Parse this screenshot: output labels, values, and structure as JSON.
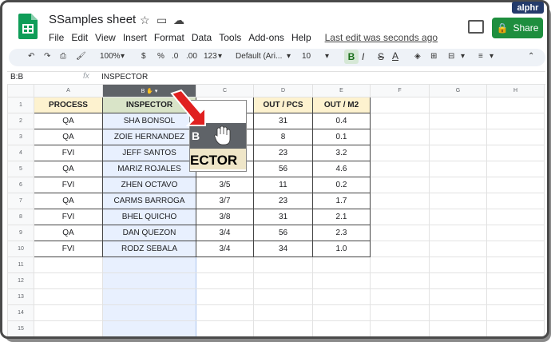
{
  "watermark": "alphr",
  "app": {
    "title": "SSamples sheet",
    "menu": [
      "File",
      "Edit",
      "View",
      "Insert",
      "Format",
      "Data",
      "Tools",
      "Add-ons",
      "Help"
    ],
    "last_edit": "Last edit was seconds ago",
    "share_label": "Share",
    "logo_color": "#0f9d58",
    "share_color": "#1e8e3e"
  },
  "toolbar": {
    "zoom": "100%",
    "currency": "$",
    "percent": "%",
    "dec_less": ".0",
    "dec_more": ".00",
    "number_format": "123",
    "font": "Default (Ari...",
    "font_size": "10",
    "bold": "B",
    "italic": "I",
    "strike": "S",
    "text_color": "A"
  },
  "formula_bar": {
    "name_box": "B:B",
    "fx": "fx",
    "value": "INSPECTOR"
  },
  "columns": [
    "A",
    "B",
    "C",
    "D",
    "E",
    "F",
    "G",
    "H"
  ],
  "table": {
    "headers": [
      "PROCESS",
      "INSPECTOR",
      "",
      "OUT / PCS",
      "OUT / M2"
    ],
    "rows": [
      [
        "QA",
        "SHA BONSOL",
        "",
        "31",
        "0.4"
      ],
      [
        "QA",
        "ZOIE HERNANDEZ",
        "",
        "8",
        "0.1"
      ],
      [
        "FVI",
        "JEFF SANTOS",
        "",
        "23",
        "3.2"
      ],
      [
        "QA",
        "MARIZ ROJALES",
        "",
        "56",
        "4.6"
      ],
      [
        "FVI",
        "ZHEN OCTAVO",
        "3/5",
        "11",
        "0.2"
      ],
      [
        "QA",
        "CARMS BARROGA",
        "3/7",
        "23",
        "1.7"
      ],
      [
        "FVI",
        "BHEL QUICHO",
        "3/8",
        "31",
        "2.1"
      ],
      [
        "QA",
        "DAN QUEZON",
        "3/4",
        "56",
        "2.3"
      ],
      [
        "FVI",
        "RODZ SEBALA",
        "3/4",
        "34",
        "1.0"
      ]
    ],
    "row_numbers": [
      "1",
      "2",
      "3",
      "4",
      "5",
      "6",
      "7",
      "8",
      "9",
      "10",
      "11",
      "12",
      "13",
      "14",
      "15"
    ]
  },
  "drag_preview": {
    "col_letter": "B",
    "fragment": "ECTOR"
  }
}
